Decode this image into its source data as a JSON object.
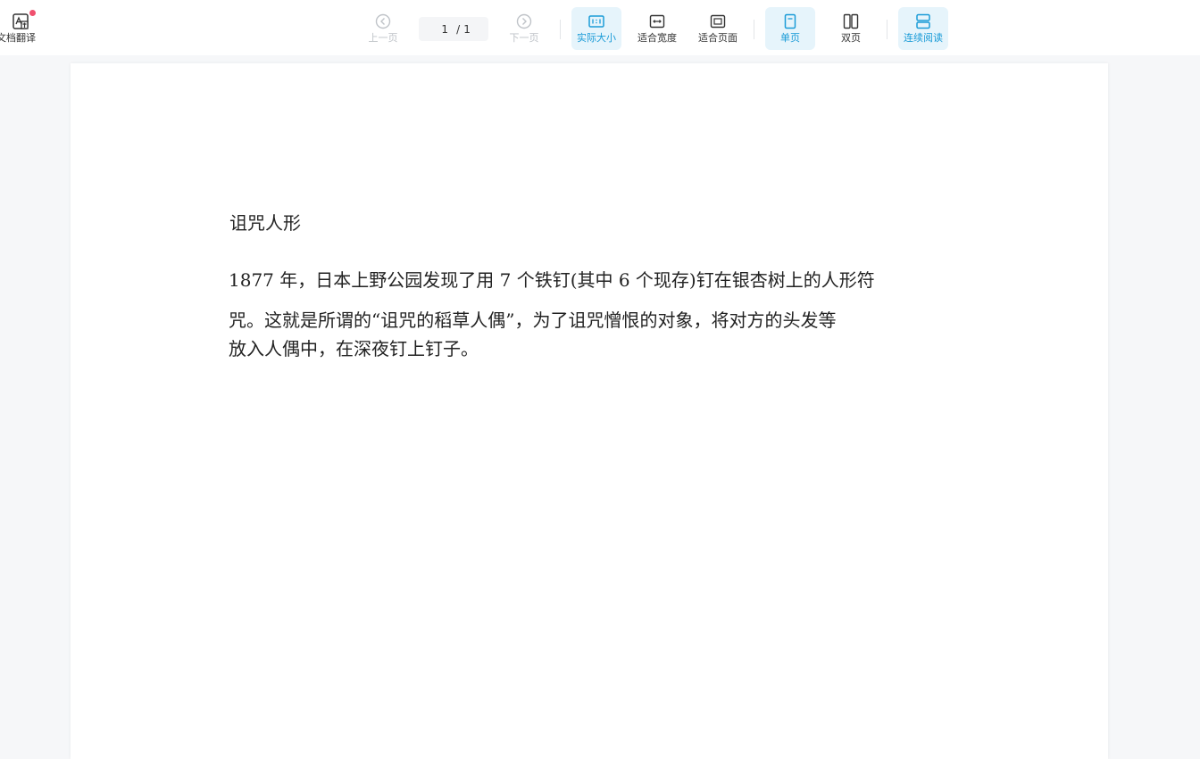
{
  "toolbar": {
    "translate_label": "文档翻译",
    "prev_label": "上一页",
    "page_current": "1",
    "page_separator": "/",
    "page_total": "1",
    "next_label": "下一页",
    "actual_size_label": "实际大小",
    "fit_width_label": "适合宽度",
    "fit_page_label": "适合页面",
    "single_page_label": "单页",
    "double_page_label": "双页",
    "continuous_label": "连续阅读"
  },
  "colors": {
    "accent": "#1a9bd7",
    "active_bg": "#e6f4fb",
    "badge": "#f0506e",
    "disabled": "#bfc3c8"
  },
  "document": {
    "title": "诅咒人形",
    "lines": [
      "1877 年，日本上野公园发现了用 7 个铁钉(其中 6 个现存)钉在银杏树上的人形符",
      "咒。这就是所谓的“诅咒的稻草人偶”，为了诅咒憎恨的对象，将对方的头发等",
      "放入人偶中，在深夜钉上钉子。"
    ]
  }
}
